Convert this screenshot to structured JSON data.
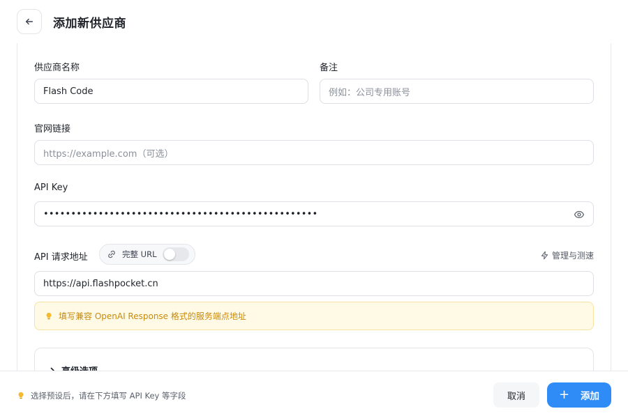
{
  "header": {
    "title": "添加新供应商"
  },
  "form": {
    "provider_name": {
      "label": "供应商名称",
      "value": "Flash Code"
    },
    "note": {
      "label": "备注",
      "placeholder": "例如：公司专用账号"
    },
    "website": {
      "label": "官网链接",
      "placeholder": "https://example.com（可选）"
    },
    "api_key": {
      "label": "API Key",
      "masked_value": "••••••••••••••••••••••••••••••••••••••••••••••••••"
    },
    "endpoint": {
      "label": "API 请求地址",
      "full_url_toggle_label": "完整 URL",
      "full_url_enabled": false,
      "manage_label": "管理与测速",
      "value": "https://api.flashpocket.cn",
      "tip": "填写兼容 OpenAI Response 格式的服务端点地址"
    },
    "advanced": {
      "label": "高级选项"
    }
  },
  "footer": {
    "hint": "选择预设后，请在下方填写 API Key 等字段",
    "cancel_label": "取消",
    "add_label": "添加"
  },
  "colors": {
    "primary": "#2f8cf6",
    "tip_bg": "#fffae6",
    "tip_text": "#c98a0b"
  },
  "icons": {
    "back": "arrow-left-icon",
    "eye": "eye-icon",
    "link": "link-icon",
    "manage": "lightning-icon",
    "tip": "lightbulb-icon",
    "advanced": "chevron-right-icon",
    "add": "plus-icon"
  }
}
